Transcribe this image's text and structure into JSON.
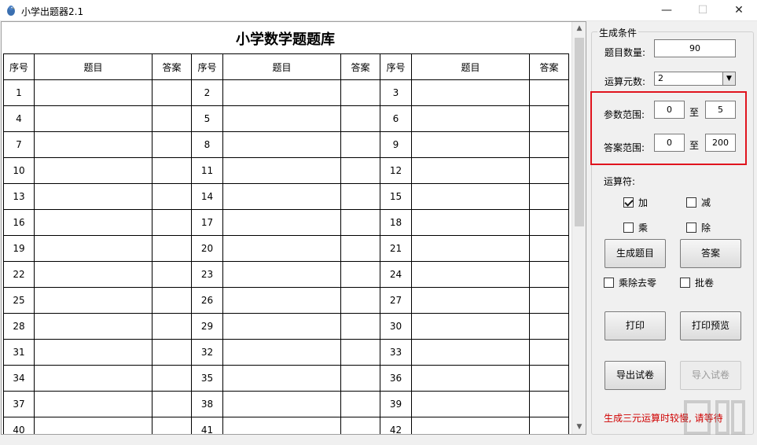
{
  "window": {
    "title": "小学出题器2.1",
    "minimize_label": "—",
    "maximize_label": "☐",
    "close_label": "✕"
  },
  "sheet": {
    "title": "小学数学题题库",
    "headers": [
      "序号",
      "题目",
      "答案",
      "序号",
      "题目",
      "答案",
      "序号",
      "题目",
      "答案"
    ],
    "rows": [
      [
        1,
        2,
        3
      ],
      [
        4,
        5,
        6
      ],
      [
        7,
        8,
        9
      ],
      [
        10,
        11,
        12
      ],
      [
        13,
        14,
        15
      ],
      [
        16,
        17,
        18
      ],
      [
        19,
        20,
        21
      ],
      [
        22,
        23,
        24
      ],
      [
        25,
        26,
        27
      ],
      [
        28,
        29,
        30
      ],
      [
        31,
        32,
        33
      ],
      [
        34,
        35,
        36
      ],
      [
        37,
        38,
        39
      ],
      [
        40,
        41,
        42
      ]
    ]
  },
  "panel": {
    "legend": "生成条件",
    "question_count_label": "题目数量:",
    "question_count_value": "90",
    "operand_count_label": "运算元数:",
    "operand_count_value": "2",
    "param_range_label": "参数范围:",
    "param_min": "0",
    "param_to": "至",
    "param_max": "5",
    "answer_range_label": "答案范围:",
    "answer_min": "0",
    "answer_to": "至",
    "answer_max": "200",
    "operators_label": "运算符:",
    "op_add": "加",
    "op_add_checked": true,
    "op_sub": "减",
    "op_mul": "乘",
    "op_div": "除",
    "generate_label": "生成题目",
    "answer_label": "答案",
    "remove_zero_label": "乘除去零",
    "grade_label": "批卷",
    "print_label": "打印",
    "print_preview_label": "打印预览",
    "export_label": "导出试卷",
    "import_label": "导入试卷",
    "status_text": "生成三元运算时较慢, 请等待"
  },
  "colors": {
    "highlight": "#e0141e",
    "status": "#d00000"
  }
}
